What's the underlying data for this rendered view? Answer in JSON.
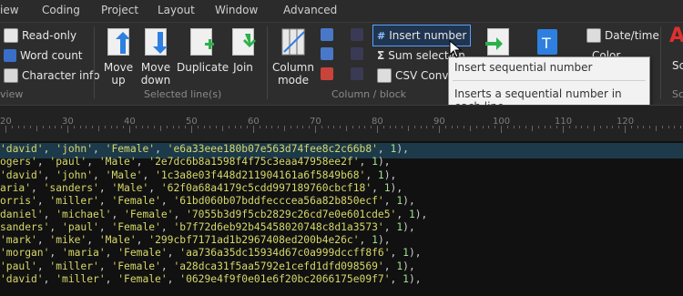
{
  "menu": {
    "items": [
      "iew",
      "Coding",
      "Project",
      "Layout",
      "Window",
      "Advanced"
    ]
  },
  "ribbon": {
    "info_group": {
      "buttons": [
        "Read-only",
        "Word count",
        "Character info"
      ],
      "label": "view"
    },
    "lines_group": {
      "buttons": [
        "Move up",
        "Move down",
        "Duplicate",
        "Join"
      ],
      "label": "Selected line(s)"
    },
    "block_group": {
      "big": "Column mode",
      "items": [
        "Insert number",
        "Sum selection",
        "CSV Converter"
      ],
      "label": "Column / block"
    },
    "misc": {
      "items": [
        "Date/time",
        "Color"
      ],
      "partial_label": "Sc",
      "partial_group": "Sc"
    }
  },
  "tooltip": {
    "title": "Insert sequential number",
    "description": "Inserts a sequential number in each line"
  },
  "ruler": {
    "labels": [
      "20",
      "30",
      "40",
      "50",
      "60",
      "70",
      "80",
      "90",
      "100",
      "110",
      "120"
    ]
  },
  "editor": {
    "lines": [
      [
        "'david'",
        "'john'",
        "'Female'",
        "'e6a33eee180b07e563d74fee8c2c66b8'",
        "1"
      ],
      [
        "ogers'",
        "'paul'",
        "'Male'",
        "'2e7dc6b8a1598f4f75c3eaa47958ee2f'",
        "1"
      ],
      [
        "'david'",
        "'john'",
        "'Male'",
        "'1c3a8e03f448d211904161a6f5849b68'",
        "1"
      ],
      [
        "aria'",
        "'sanders'",
        "'Male'",
        "'62f0a68a4179c5cdd997189760cbcf18'",
        "1"
      ],
      [
        "orris'",
        "'miller'",
        "'Female'",
        "'61bd060b07bddfeccceа56a82b850ecf'",
        "1"
      ],
      [
        "daniel'",
        "'michael'",
        "'Female'",
        "'7055b3d9f5cb2829c26cd7e0e601cde5'",
        "1"
      ],
      [
        "sanders'",
        "'paul'",
        "'Female'",
        "'b7f72d6eb92b45458020748c8d1a3573'",
        "1"
      ],
      [
        "'mark'",
        "'mike'",
        "'Male'",
        "'299cbf7171ad1b2967408ed200b4e26c'",
        "1"
      ],
      [
        "'morgan'",
        "'maria'",
        "'Female'",
        "'aa736a35dc15934d67c0a999dccff8f6'",
        "1"
      ],
      [
        "'paul'",
        "'miller'",
        "'Female'",
        "'a28dca31f5aa5792e1cefd1dfd098569'",
        "1"
      ],
      [
        "'david'",
        "'miller'",
        "'Female'",
        "'0629e4f9f0e01e6f20bc2066175e09f7'",
        "1"
      ]
    ]
  }
}
